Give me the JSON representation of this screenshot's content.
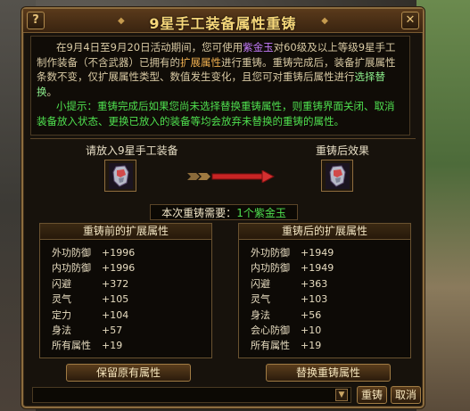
{
  "window": {
    "title": "9星手工装备属性重铸",
    "help_label": "?",
    "close_label": "✕"
  },
  "info": {
    "para1": [
      {
        "t": "在9月4日至9月20日活动期间，您可使用",
        "c": ""
      },
      {
        "t": "紫金玉",
        "c": "purple"
      },
      {
        "t": "对60级及以上等级9星手工制作装备（不含武器）已拥有的",
        "c": ""
      },
      {
        "t": "扩展属性",
        "c": "orange"
      },
      {
        "t": "进行重铸。重铸完成后，装备扩展属性条数不变，仅扩展属性类型、数值发生变化，且您可对重铸后属性进行",
        "c": ""
      },
      {
        "t": "选择替换",
        "c": "green"
      },
      {
        "t": "。",
        "c": ""
      }
    ],
    "tip": "小提示：重铸完成后如果您尚未选择替换重铸属性，则重铸界面关闭、取消装备放入状态、更换已放入的装备等均会放弃未替换的重铸的属性。"
  },
  "slots": {
    "left_label": "请放入9星手工装备",
    "right_label": "重铸后效果"
  },
  "cost": {
    "label": "本次重铸需要：",
    "value": "1个紫金玉"
  },
  "before": {
    "header": "重铸前的扩展属性",
    "rows": [
      {
        "name": "外功防御",
        "value": "+1996"
      },
      {
        "name": "内功防御",
        "value": "+1996"
      },
      {
        "name": "闪避",
        "value": "+372"
      },
      {
        "name": "灵气",
        "value": "+105"
      },
      {
        "name": "定力",
        "value": "+104"
      },
      {
        "name": "身法",
        "value": "+57"
      },
      {
        "name": "所有属性",
        "value": "+19"
      }
    ]
  },
  "after": {
    "header": "重铸后的扩展属性",
    "rows": [
      {
        "name": "外功防御",
        "value": "+1949"
      },
      {
        "name": "内功防御",
        "value": "+1949"
      },
      {
        "name": "闪避",
        "value": "+363"
      },
      {
        "name": "灵气",
        "value": "+103"
      },
      {
        "name": "身法",
        "value": "+56"
      },
      {
        "name": "会心防御",
        "value": "+10"
      },
      {
        "name": "所有属性",
        "value": "+19"
      }
    ]
  },
  "buttons": {
    "keep": "保留原有属性",
    "replace": "替换重铸属性",
    "recast": "重铸",
    "cancel": "取消",
    "chat_toggle": "▼"
  },
  "colors": {
    "purple": "#c77dff",
    "green": "#8df08d",
    "orange": "#f0b050",
    "tip": "#4fe04f",
    "frame": "#8c6d3f"
  }
}
